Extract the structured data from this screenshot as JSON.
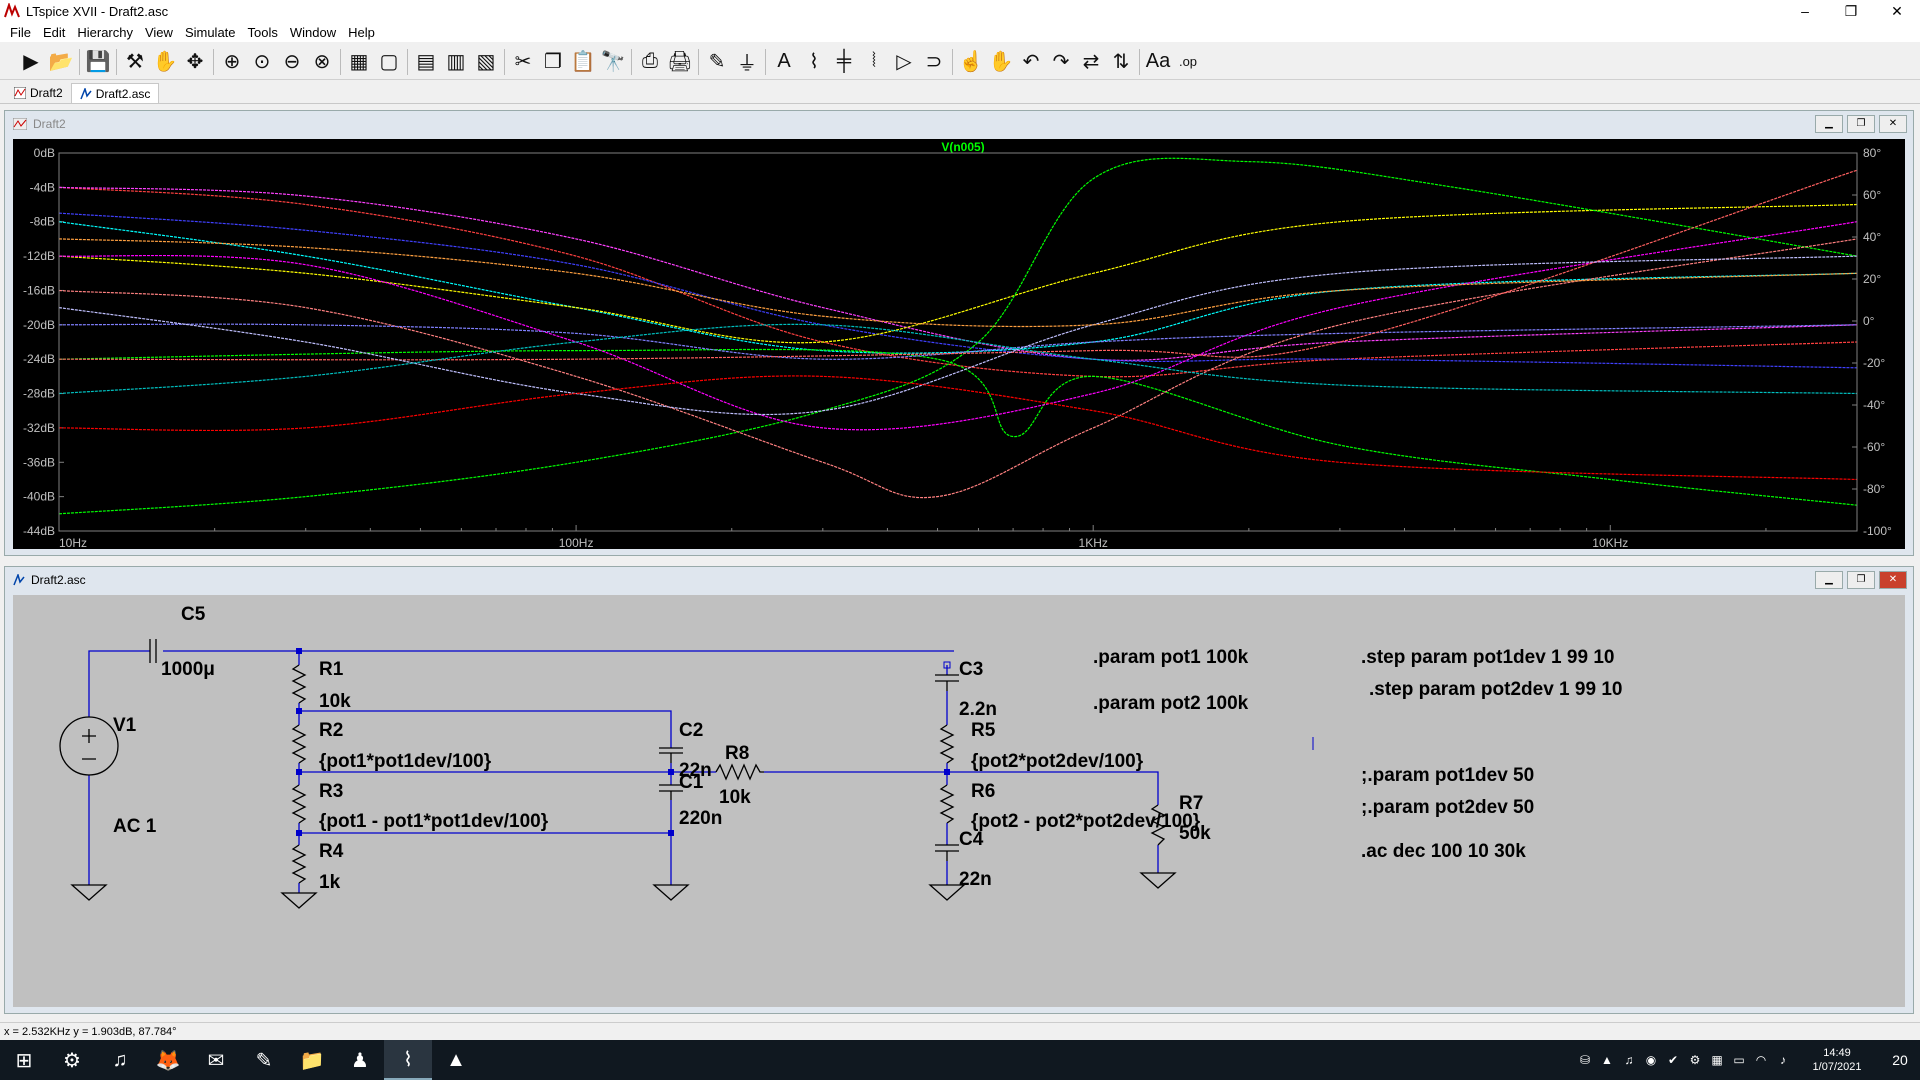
{
  "window": {
    "title": "LTspice XVII - Draft2.asc",
    "minimize": "–",
    "maximize": "❐",
    "close": "✕"
  },
  "menu": [
    "File",
    "Edit",
    "Hierarchy",
    "View",
    "Simulate",
    "Tools",
    "Window",
    "Help"
  ],
  "toolbar": {
    "icons": [
      "run-icon",
      "open-icon",
      "save-icon",
      "control-panel-icon",
      "halt-icon",
      "pan-icon",
      "zoom-in-icon",
      "zoom-fit-icon",
      "zoom-out-icon",
      "zoom-cancel-icon",
      "autorange-icon",
      "grid-icon",
      "tile-horizontal-icon",
      "cascade-icon",
      "tile-vertical-icon",
      "cut-icon",
      "copy-icon",
      "paste-icon",
      "find-icon",
      "print-preview-icon",
      "print-icon",
      "draw-wire-icon",
      "ground-icon",
      "label-net-icon",
      "resistor-icon",
      "capacitor-icon",
      "inductor-icon",
      "diode-icon",
      "component-icon",
      "move-icon",
      "drag-icon",
      "undo-icon",
      "redo-icon",
      "rotate-icon",
      "mirror-icon",
      "text-icon",
      "spice-directive-icon"
    ],
    "glyphs": [
      "▶",
      "📂",
      "💾",
      "⚒",
      "✋",
      "✥",
      "⊕",
      "⊙",
      "⊖",
      "⊗",
      "▦",
      "▢",
      "▤",
      "▥",
      "▧",
      "✂",
      "❐",
      "📋",
      "🔭",
      "⎙",
      "🖨",
      "✎",
      "⏚",
      "A",
      "⌇",
      "╪",
      "⦚",
      "▷",
      "⊃",
      "☝",
      "✋",
      "↶",
      "↷",
      "⇄",
      "⇅",
      "Aa",
      ".op"
    ],
    "op_label": ".op"
  },
  "tabs": [
    {
      "label": "Draft2",
      "icon": "waveform-icon",
      "active": false
    },
    {
      "label": "Draft2.asc",
      "icon": "schematic-icon",
      "active": true
    }
  ],
  "waveform_window": {
    "title": "Draft2",
    "trace_label": "V(n005)",
    "trace_color": "#00ff00"
  },
  "chart_data": {
    "type": "line",
    "title": "V(n005)",
    "x_scale": "log",
    "x_range": [
      10,
      30000
    ],
    "x_ticks": [
      "10Hz",
      "100Hz",
      "1KHz",
      "10KHz"
    ],
    "x_tick_values": [
      10,
      100,
      1000,
      10000
    ],
    "y_left_range": [
      -44,
      0
    ],
    "y_left_ticks": [
      "0dB",
      "-4dB",
      "-8dB",
      "-12dB",
      "-16dB",
      "-20dB",
      "-24dB",
      "-28dB",
      "-32dB",
      "-36dB",
      "-40dB",
      "-44dB"
    ],
    "y_right_range": [
      -100,
      80
    ],
    "y_right_ticks": [
      "80°",
      "60°",
      "40°",
      "20°",
      "0°",
      "-20°",
      "-40°",
      "-60°",
      "-80°",
      "-100°"
    ],
    "grid": false,
    "background": "#000000",
    "series_note": "",
    "series": [
      {
        "color": "#ff4040",
        "values": [
          [
            10,
            -4
          ],
          [
            30,
            -6
          ],
          [
            100,
            -12
          ],
          [
            300,
            -22
          ],
          [
            1000,
            -26
          ],
          [
            3000,
            -24
          ],
          [
            30000,
            -22
          ]
        ]
      },
      {
        "color": "#ff40ff",
        "values": [
          [
            10,
            -4
          ],
          [
            30,
            -5
          ],
          [
            100,
            -10
          ],
          [
            300,
            -18
          ],
          [
            1000,
            -24
          ],
          [
            3000,
            -22
          ],
          [
            30000,
            -20
          ]
        ]
      },
      {
        "color": "#4040ff",
        "values": [
          [
            10,
            -7
          ],
          [
            30,
            -9
          ],
          [
            100,
            -13
          ],
          [
            300,
            -20
          ],
          [
            1000,
            -24
          ],
          [
            3000,
            -24
          ],
          [
            30000,
            -25
          ]
        ]
      },
      {
        "color": "#00ffff",
        "values": [
          [
            10,
            -8
          ],
          [
            30,
            -12
          ],
          [
            100,
            -18
          ],
          [
            300,
            -23
          ],
          [
            1000,
            -22
          ],
          [
            3000,
            -16
          ],
          [
            30000,
            -14
          ]
        ]
      },
      {
        "color": "#ffff00",
        "values": [
          [
            10,
            -12
          ],
          [
            30,
            -14
          ],
          [
            100,
            -18
          ],
          [
            300,
            -22
          ],
          [
            1000,
            -14
          ],
          [
            3000,
            -8
          ],
          [
            30000,
            -6
          ]
        ]
      },
      {
        "color": "#00ff00",
        "values": [
          [
            10,
            -42
          ],
          [
            30,
            -40
          ],
          [
            100,
            -36
          ],
          [
            300,
            -30
          ],
          [
            600,
            -22
          ],
          [
            1000,
            -3
          ],
          [
            2000,
            -1
          ],
          [
            5000,
            -4
          ],
          [
            30000,
            -12
          ]
        ]
      },
      {
        "color": "#00ff00",
        "values": [
          [
            10,
            -24
          ],
          [
            100,
            -23
          ],
          [
            500,
            -24
          ],
          [
            700,
            -33
          ],
          [
            1000,
            -26
          ],
          [
            3000,
            -34
          ],
          [
            10000,
            -38
          ],
          [
            30000,
            -41
          ]
        ]
      },
      {
        "color": "#ff8080",
        "values": [
          [
            10,
            -16
          ],
          [
            30,
            -18
          ],
          [
            100,
            -26
          ],
          [
            300,
            -36
          ],
          [
            500,
            -40
          ],
          [
            1000,
            -32
          ],
          [
            3000,
            -20
          ],
          [
            30000,
            -10
          ]
        ]
      },
      {
        "color": "#ff00ff",
        "values": [
          [
            10,
            -12
          ],
          [
            30,
            -13
          ],
          [
            100,
            -22
          ],
          [
            300,
            -32
          ],
          [
            1000,
            -28
          ],
          [
            3000,
            -18
          ],
          [
            30000,
            -8
          ]
        ]
      },
      {
        "color": "#8080ff",
        "values": [
          [
            10,
            -20
          ],
          [
            30,
            -20
          ],
          [
            100,
            -21
          ],
          [
            300,
            -24
          ],
          [
            1000,
            -22
          ],
          [
            3000,
            -21
          ],
          [
            30000,
            -20
          ]
        ]
      },
      {
        "color": "#ff6060",
        "values": [
          [
            10,
            -24
          ],
          [
            100,
            -24
          ],
          [
            1000,
            -23
          ],
          [
            3000,
            -22
          ],
          [
            30000,
            -2
          ]
        ]
      },
      {
        "color": "#c0c0ff",
        "values": [
          [
            10,
            -18
          ],
          [
            30,
            -22
          ],
          [
            100,
            -28
          ],
          [
            300,
            -30
          ],
          [
            1000,
            -20
          ],
          [
            3000,
            -14
          ],
          [
            30000,
            -12
          ]
        ]
      },
      {
        "color": "#ff0000",
        "values": [
          [
            10,
            -32
          ],
          [
            30,
            -32
          ],
          [
            100,
            -28
          ],
          [
            300,
            -26
          ],
          [
            1000,
            -30
          ],
          [
            3000,
            -36
          ],
          [
            30000,
            -38
          ]
        ]
      },
      {
        "color": "#00c0c0",
        "values": [
          [
            10,
            -28
          ],
          [
            30,
            -26
          ],
          [
            100,
            -22
          ],
          [
            300,
            -20
          ],
          [
            1000,
            -24
          ],
          [
            3000,
            -27
          ],
          [
            30000,
            -28
          ]
        ]
      },
      {
        "color": "#ffa040",
        "values": [
          [
            10,
            -10
          ],
          [
            30,
            -11
          ],
          [
            100,
            -14
          ],
          [
            300,
            -19
          ],
          [
            1000,
            -20
          ],
          [
            3000,
            -16
          ],
          [
            30000,
            -14
          ]
        ]
      }
    ]
  },
  "schematic_window": {
    "title": "Draft2.asc"
  },
  "schematic": {
    "components": {
      "C5": {
        "name": "C5",
        "value": "1000μ"
      },
      "V1": {
        "name": "V1",
        "value": "AC 1"
      },
      "R1": {
        "name": "R1",
        "value": "10k"
      },
      "R2": {
        "name": "R2",
        "value": "{pot1*pot1dev/100}"
      },
      "R3": {
        "name": "R3",
        "value": "{pot1 - pot1*pot1dev/100}"
      },
      "R4": {
        "name": "R4",
        "value": "1k"
      },
      "C2": {
        "name": "C2",
        "value": "22n"
      },
      "C1": {
        "name": "C1",
        "value": "220n"
      },
      "R8": {
        "name": "R8",
        "value": "10k"
      },
      "C3": {
        "name": "C3",
        "value": "2.2n"
      },
      "R5": {
        "name": "R5",
        "value": "{pot2*pot2dev/100}"
      },
      "R6": {
        "name": "R6",
        "value": "{pot2 - pot2*pot2dev/100}"
      },
      "C4": {
        "name": "C4",
        "value": "22n"
      },
      "R7": {
        "name": "R7",
        "value": "50k"
      }
    },
    "directives": {
      "param_pot1": ".param pot1 100k",
      "param_pot2": ".param pot2 100k",
      "step_pot1": ".step param pot1dev 1 99 10",
      "step_pot2": ".step param pot2dev 1 99 10",
      "param_pot1dev": ";.param pot1dev 50",
      "param_pot2dev": ";.param pot2dev 50",
      "ac": ".ac dec 100 10 30k"
    },
    "wire_color": "#0000cc",
    "component_color": "#000000",
    "background": "#c0c0c0"
  },
  "statusbar": {
    "text": "x = 2.532KHz    y = 1.903dB, 87.784°"
  },
  "taskbar": {
    "apps": [
      "windows-start-icon",
      "settings-icon",
      "spotify-icon",
      "firefox-icon",
      "editor-icon",
      "notes-icon",
      "file-explorer-icon",
      "game-icon",
      "ltspice-icon",
      "vlc-icon"
    ],
    "glyphs": [
      "⊞",
      "⚙",
      "♫",
      "🦊",
      "✉",
      "✎",
      "📁",
      "♟",
      "⌇",
      "▲"
    ],
    "tray_glyphs": [
      "⛁",
      "▲",
      "♫",
      "◉",
      "✔",
      "⚙",
      "▦",
      "▭",
      "◠",
      "♪"
    ],
    "time": "14:49",
    "date": "1/07/2021",
    "notifications": "20"
  }
}
